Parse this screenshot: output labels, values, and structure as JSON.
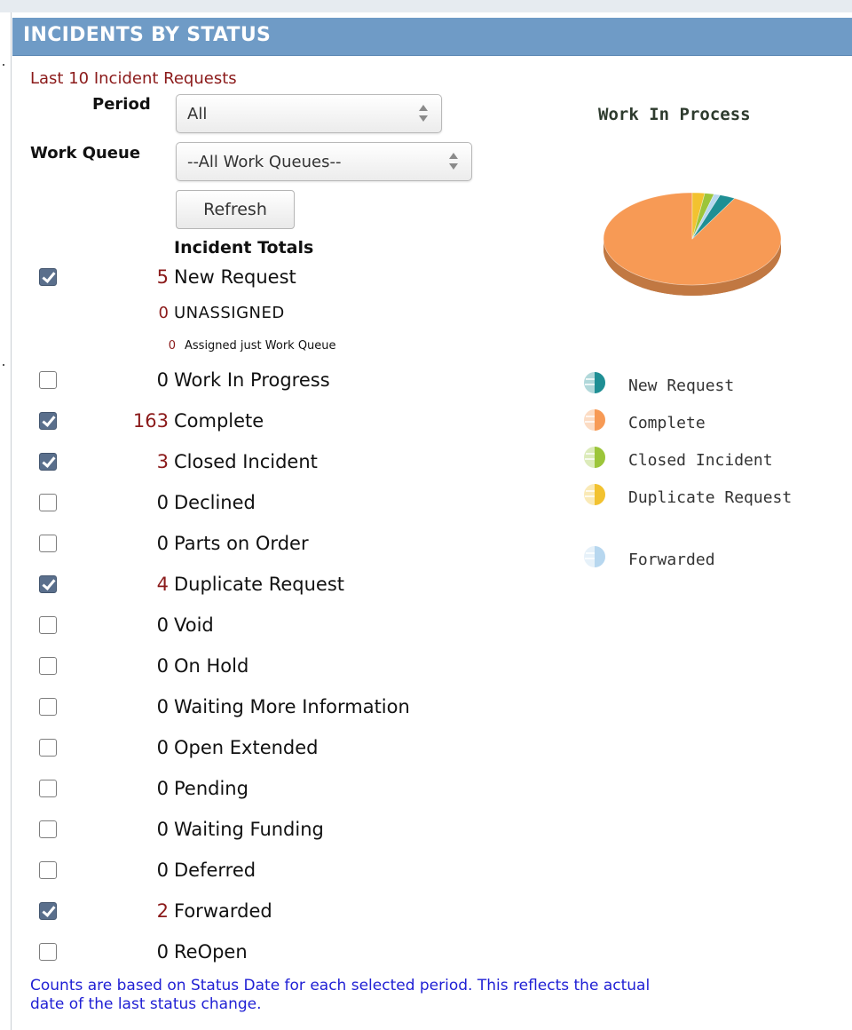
{
  "header": {
    "title": "INCIDENTS BY STATUS"
  },
  "subtitle": "Last 10 Incident Requests",
  "filters": {
    "period_label": "Period",
    "period_value": "All",
    "queue_label": "Work Queue",
    "queue_value": "--All Work Queues--",
    "refresh_label": "Refresh"
  },
  "totals_heading": "Incident Totals",
  "status_rows": [
    {
      "count": "5",
      "label": "New Request",
      "checked": true,
      "highlight": true
    },
    {
      "count": "0",
      "label": "Work In Progress",
      "checked": false,
      "highlight": false
    },
    {
      "count": "163",
      "label": "Complete",
      "checked": true,
      "highlight": true
    },
    {
      "count": "3",
      "label": "Closed Incident",
      "checked": true,
      "highlight": true
    },
    {
      "count": "0",
      "label": "Declined",
      "checked": false,
      "highlight": false
    },
    {
      "count": "0",
      "label": "Parts on Order",
      "checked": false,
      "highlight": false
    },
    {
      "count": "4",
      "label": "Duplicate Request",
      "checked": true,
      "highlight": true
    },
    {
      "count": "0",
      "label": "Void",
      "checked": false,
      "highlight": false
    },
    {
      "count": "0",
      "label": "On Hold",
      "checked": false,
      "highlight": false
    },
    {
      "count": "0",
      "label": "Waiting More Information",
      "checked": false,
      "highlight": false
    },
    {
      "count": "0",
      "label": "Open Extended",
      "checked": false,
      "highlight": false
    },
    {
      "count": "0",
      "label": "Pending",
      "checked": false,
      "highlight": false
    },
    {
      "count": "0",
      "label": "Waiting Funding",
      "checked": false,
      "highlight": false
    },
    {
      "count": "0",
      "label": "Deferred",
      "checked": false,
      "highlight": false
    },
    {
      "count": "2",
      "label": "Forwarded",
      "checked": true,
      "highlight": true
    },
    {
      "count": "0",
      "label": "ReOpen",
      "checked": false,
      "highlight": false
    }
  ],
  "new_request_breakdown": {
    "unassigned_count": "0",
    "unassigned_label": "UNASSIGNED",
    "assigned_queue_count": "0",
    "assigned_queue_label": "Assigned just Work Queue"
  },
  "footnote": "Counts are based on Status Date for each selected period. This reflects the actual\ndate of the last status change.",
  "chart_data": {
    "type": "pie",
    "title": "Work In Process",
    "series": [
      {
        "name": "New Request",
        "value": 5,
        "color": "#1f8f94"
      },
      {
        "name": "Complete",
        "value": 163,
        "color": "#f79a55"
      },
      {
        "name": "Closed Incident",
        "value": 3,
        "color": "#9cc53a"
      },
      {
        "name": "Duplicate Request",
        "value": 4,
        "color": "#f2c230"
      },
      {
        "name": "Forwarded",
        "value": 2,
        "color": "#b7d7ef"
      }
    ],
    "legend_position": "bottom",
    "style": "3d"
  }
}
